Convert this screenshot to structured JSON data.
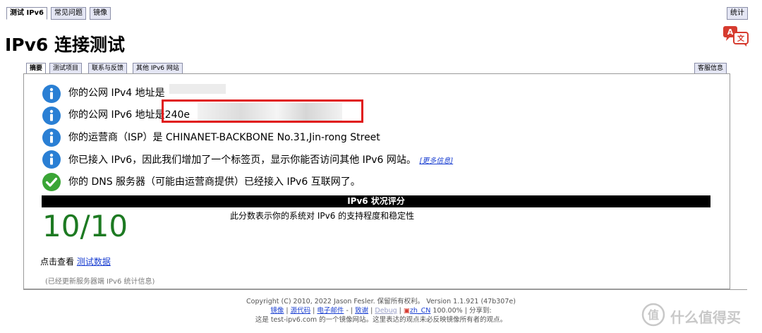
{
  "top_tabs": [
    {
      "label": "测试 IPv6",
      "active": true
    },
    {
      "label": "常见问题",
      "active": false
    },
    {
      "label": "镜像",
      "active": false
    }
  ],
  "stats_tab": "统计",
  "page_title": "IPv6 连接测试",
  "sub_tabs": [
    {
      "label": "摘要",
      "active": true
    },
    {
      "label": "测试项目",
      "active": false
    },
    {
      "label": "联系与反馈",
      "active": false
    },
    {
      "label": "其他 IPv6 网站",
      "active": false
    }
  ],
  "client_info_tab": "客服信息",
  "rows": [
    {
      "icon": "info-icon",
      "text": "你的公网 IPv4 地址是"
    },
    {
      "icon": "info-icon",
      "text": "你的公网 IPv6 地址是",
      "value": "240e"
    },
    {
      "icon": "info-icon",
      "text": "你的运营商（ISP）是 CHINANET-BACKBONE No.31,Jin-rong Street"
    },
    {
      "icon": "info-icon",
      "text": "你已接入 IPv6，因此我们增加了一个标签页，显示你能否访问其他 IPv6 网站。",
      "link": "[更多信息]"
    },
    {
      "icon": "check-icon",
      "text": "你的 DNS 服务器（可能由运营商提供）已经接入 IPv6 互联网了。"
    }
  ],
  "score_header": "IPv6 状况评分",
  "score": "10/10",
  "score_desc": "此分数表示你的系统对 IPv6 的支持程度和稳定性",
  "view_data_prefix": "点击查看",
  "view_data_link": "测试数据",
  "stats_note": "(已经更新服务器端 IPv6 统计信息)",
  "footer": {
    "copyright": "Copyright (C) 2010, 2022 Jason Fesler. 保留所有权利。 Version 1.1.921 (47b307e)",
    "links": [
      "镜像",
      "源代码",
      "电子邮件",
      "-",
      "致谢",
      "Debug",
      "zh_CN",
      "100.00%",
      "分享到:"
    ],
    "mirror_note": "这是 test-ipv6.com 的一个镜像网站。这里表达的观点未必反映镜像所有者的观点。"
  },
  "watermark": "什么值得买",
  "colors": {
    "info_blue": "#2a7fd4",
    "check_green": "#3aa536",
    "score_green": "#1d7a22",
    "highlight_red": "#e01818",
    "link_blue": "#1a3fd1"
  }
}
